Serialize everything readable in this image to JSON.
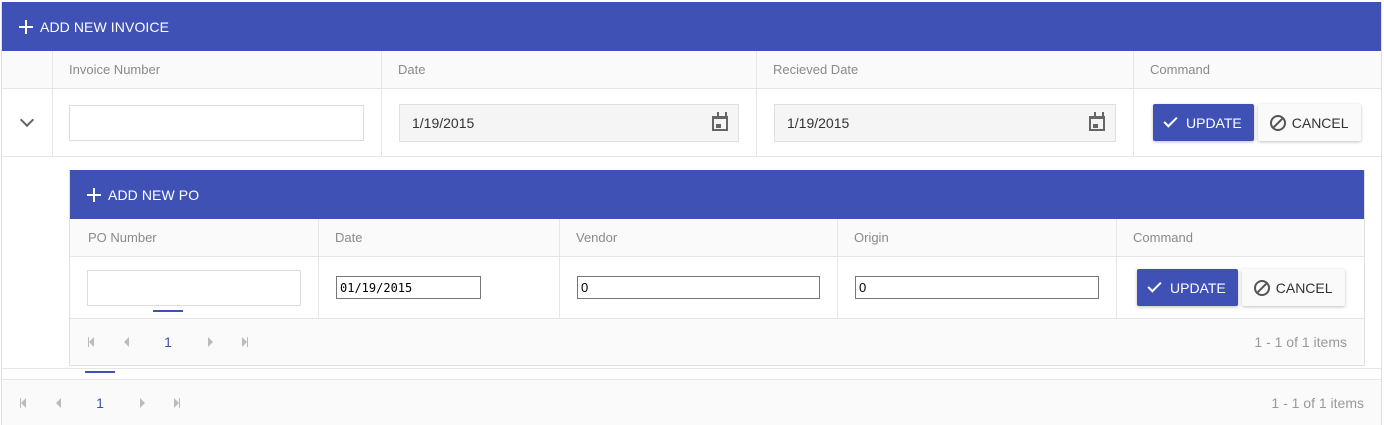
{
  "main": {
    "toolbar": {
      "add_label": "ADD NEW INVOICE"
    },
    "columns": [
      "Invoice Number",
      "Date",
      "Recieved Date",
      "Command"
    ],
    "edit_row": {
      "invoice_number": "",
      "date": "1/19/2015",
      "received_date": "1/19/2015",
      "update_label": "UPDATE",
      "cancel_label": "CANCEL"
    },
    "pager": {
      "page": "1",
      "info": "1 - 1 of 1 items"
    }
  },
  "detail": {
    "toolbar": {
      "add_label": "ADD NEW PO"
    },
    "columns": [
      "PO Number",
      "Date",
      "Vendor",
      "Origin",
      "Command"
    ],
    "edit_row": {
      "po_number": "",
      "date": "01/19/2015",
      "vendor": "0",
      "origin": "0",
      "update_label": "UPDATE",
      "cancel_label": "CANCEL"
    },
    "pager": {
      "page": "1",
      "info": "1 - 1 of 1 items"
    }
  },
  "colors": {
    "primary": "#3f51b5",
    "header_bg": "#fafafa",
    "border": "#e6e6e6"
  },
  "icons": [
    "plus-icon",
    "chevron-down-icon",
    "calendar-icon",
    "check-icon",
    "cancel-icon",
    "first-page-icon",
    "prev-page-icon",
    "next-page-icon",
    "last-page-icon"
  ]
}
